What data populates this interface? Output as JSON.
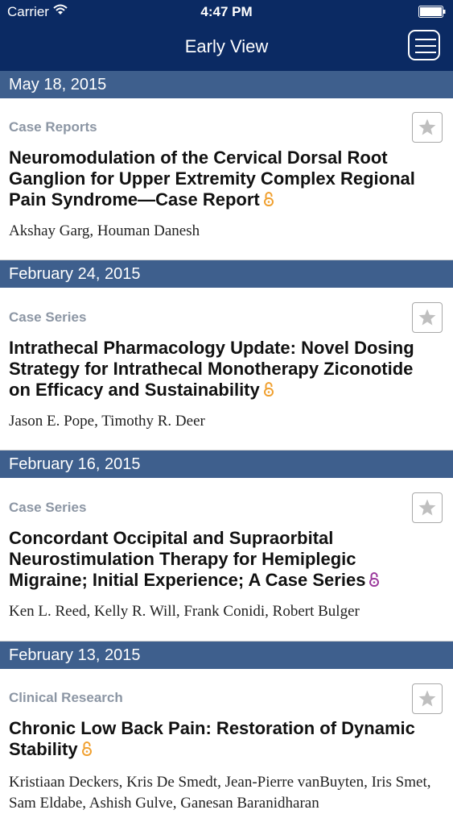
{
  "status_bar": {
    "carrier": "Carrier",
    "time": "4:47 PM"
  },
  "nav": {
    "title": "Early View"
  },
  "articles": [
    {
      "date": "May 18, 2015",
      "category": "Case Reports",
      "title": "Neuromodulation of the Cervical Dorsal Root Ganglion for Upper Extremity Complex Regional Pain Syndrome—Case Report",
      "authors": "Akshay Garg, Houman Danesh",
      "lock_color": "#f0a030"
    },
    {
      "date": "February 24, 2015",
      "category": "Case Series",
      "title": "Intrathecal Pharmacology Update: Novel Dosing Strategy for Intrathecal Monotherapy Ziconotide on Efficacy and Sustainability",
      "authors": "Jason E. Pope, Timothy R. Deer",
      "lock_color": "#f0a030"
    },
    {
      "date": "February 16, 2015",
      "category": "Case Series",
      "title": "Concordant Occipital and Supraorbital Neurostimulation Therapy for Hemiplegic Migraine; Initial Experience; A Case Series",
      "authors": "Ken L. Reed, Kelly R. Will, Frank Conidi, Robert Bulger",
      "lock_color": "#9b3a9c"
    },
    {
      "date": "February 13, 2015",
      "category": "Clinical Research",
      "title": "Chronic Low Back Pain: Restoration of Dynamic Stability",
      "authors": "Kristiaan Deckers, Kris De Smedt, Jean-Pierre vanBuyten, Iris Smet, Sam Eldabe, Ashish Gulve, Ganesan Baranidharan",
      "lock_color": "#f0a030"
    }
  ],
  "icons": {
    "wifi": "wifi-icon",
    "battery": "battery-icon",
    "menu": "menu-icon",
    "favorite": "star-icon",
    "open_access": "open-lock-icon"
  },
  "colors": {
    "nav_bar": "#0b2a63",
    "date_band": "#3e5f8d",
    "category_text": "#8c96a4"
  }
}
